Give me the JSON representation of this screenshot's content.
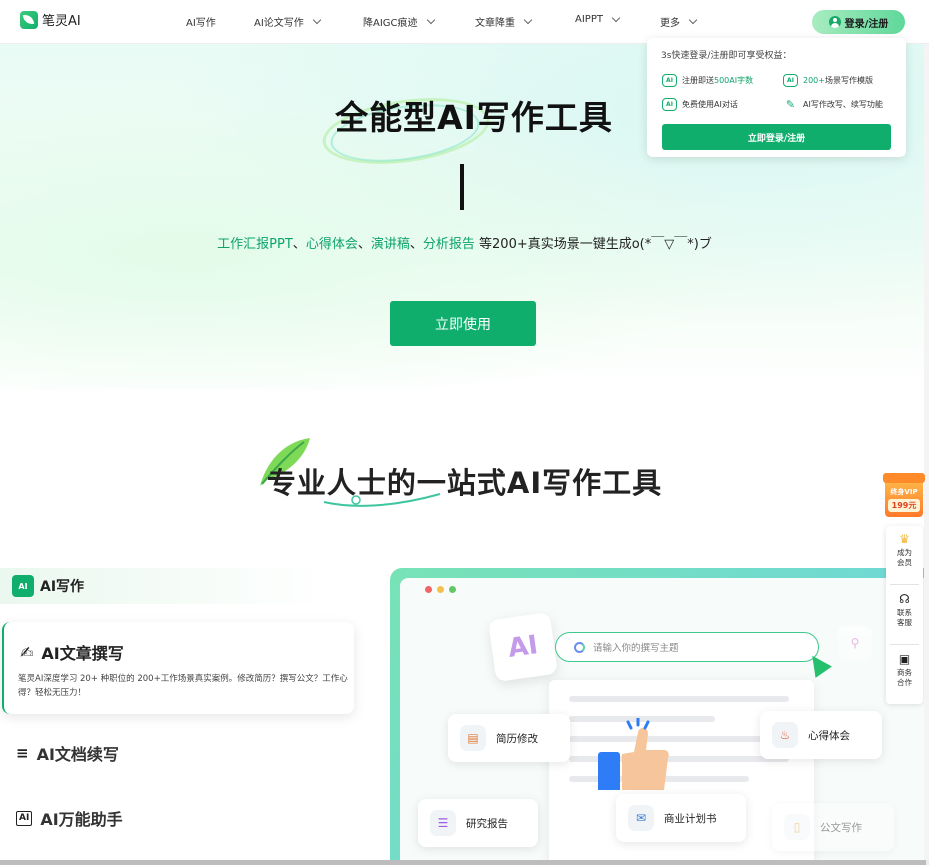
{
  "header": {
    "logo_text": "笔灵AI",
    "nav": [
      {
        "label": "AI写作",
        "has_dropdown": false
      },
      {
        "label": "AI论文写作",
        "has_dropdown": true
      },
      {
        "label": "降AIGC痕迹",
        "has_dropdown": true
      },
      {
        "label": "文章降重",
        "has_dropdown": true
      },
      {
        "label": "AIPPT",
        "has_dropdown": true
      },
      {
        "label": "更多",
        "has_dropdown": true
      }
    ],
    "login_label": "登录/注册"
  },
  "popup": {
    "title": "3s快速登录/注册即可享受权益：",
    "benefits": [
      {
        "icon": "AI-doc-icon",
        "text_pre": "注册即送",
        "text_hl": "500AI字数"
      },
      {
        "icon": "AI-template-icon",
        "text_pre": "",
        "text_hl": "200+",
        "text_post": "场景写作模版"
      },
      {
        "icon": "AI-chat-icon",
        "text_pre": "免费使用AI对话",
        "text_hl": ""
      },
      {
        "icon": "pen-icon",
        "text_pre": "AI写作改写、续写功能",
        "text_hl": ""
      }
    ],
    "button_label": "立即登录/注册"
  },
  "hero": {
    "title": "全能型AI写作工具",
    "subtitle_highlights": [
      "工作汇报PPT",
      "心得体会",
      "演讲稿",
      "分析报告"
    ],
    "subtitle_separators": [
      "、",
      "、",
      "、"
    ],
    "subtitle_tail": " 等200+真实场景一键生成o(*￣▽￣*)ブ",
    "cta_label": "立即使用"
  },
  "section": {
    "title": "专业人士的一站式AI写作工具",
    "tag_label": "AI写作",
    "tag_icon_text": "AI",
    "card": {
      "title": "AI文章撰写",
      "desc": "笔灵AI深度学习 20+ 种职位的 200+工作场景真实案例。修改简历？撰写公文？工作心得？轻松无压力！"
    },
    "features": [
      {
        "label": "AI文档续写",
        "icon": "continue-write-icon"
      },
      {
        "label": "AI万能助手",
        "icon": "assistant-icon"
      }
    ]
  },
  "mockup": {
    "ai_tile_text": "AI",
    "search_placeholder": "请输入你的撰写主题",
    "pills": [
      {
        "label": "简历修改",
        "icon": "resume-icon",
        "color": "#e07b39"
      },
      {
        "label": "心得体会",
        "icon": "flame-icon",
        "color": "#e4572e"
      },
      {
        "label": "研究报告",
        "icon": "report-icon",
        "color": "#9b5de5"
      },
      {
        "label": "商业计划书",
        "icon": "envelope-icon",
        "color": "#3a7bd5"
      },
      {
        "label": "公文写作",
        "icon": "document-icon",
        "color": "#e0a030"
      }
    ]
  },
  "float_bar": {
    "vip_text": "终身VIP",
    "vip_price": "199元",
    "items": [
      {
        "label": "成为会员",
        "icon": "crown-icon"
      },
      {
        "label": "联系客服",
        "icon": "headset-icon"
      },
      {
        "label": "商务合作",
        "icon": "briefcase-icon"
      }
    ]
  },
  "colors": {
    "brand": "#0fae6d",
    "highlight": "#0fa36b"
  }
}
